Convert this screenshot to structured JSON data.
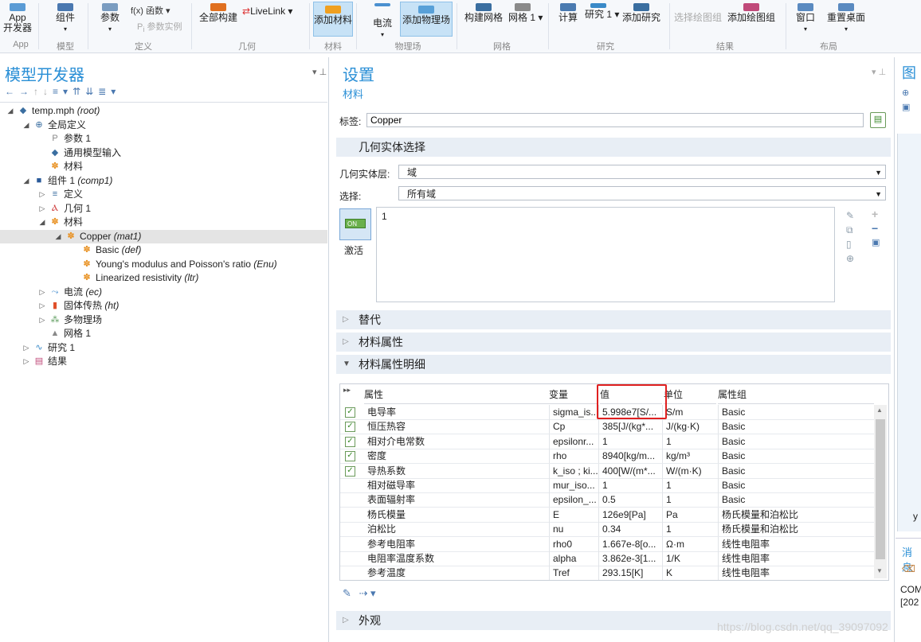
{
  "ribbon": {
    "app_builder": "App\n开发器",
    "components": "组件",
    "parameters": "参数",
    "functions": "f(x) 函数",
    "param_instance": "参数实例",
    "build_all": "全部构建",
    "livelink": "LiveLink",
    "add_material": "添加材料",
    "current": "电流",
    "add_multiphysics": "添加物理场",
    "build_mesh": "构建网格",
    "mesh1": "网格 1",
    "compute": "计算",
    "study1": "研究 1",
    "add_study": "添加研究",
    "select_plot_group": "选择绘图组",
    "add_plot_group": "添加绘图组",
    "window": "窗口",
    "reset_desktop": "重置桌面",
    "groups": [
      "App",
      "模型",
      "定义",
      "几何",
      "材料",
      "物理场",
      "网格",
      "研究",
      "结果",
      "布局"
    ]
  },
  "left": {
    "title": "模型开发器",
    "tree": [
      {
        "text": "temp.mph",
        "tag": "(root)",
        "icon": "document-icon"
      },
      {
        "text": "全局定义",
        "tag": "",
        "icon": "globe-icon"
      },
      {
        "text": "参数 1",
        "tag": "",
        "icon": "parameter-icon"
      },
      {
        "text": "通用模型输入",
        "tag": "",
        "icon": "model-input-icon"
      },
      {
        "text": "材料",
        "tag": "",
        "icon": "material-icon"
      },
      {
        "text": "组件 1",
        "tag": "(comp1)",
        "icon": "component-icon"
      },
      {
        "text": "定义",
        "tag": "",
        "icon": "definitions-icon"
      },
      {
        "text": "几何 1",
        "tag": "",
        "icon": "geometry-icon"
      },
      {
        "text": "材料",
        "tag": "",
        "icon": "material-icon"
      },
      {
        "text": "Copper",
        "tag": "(mat1)",
        "icon": "material-icon"
      },
      {
        "text": "Basic",
        "tag": "(def)",
        "icon": "material-icon"
      },
      {
        "text": "Young's modulus and Poisson's ratio",
        "tag": "(Enu)",
        "icon": "material-icon"
      },
      {
        "text": "Linearized resistivity",
        "tag": "(ltr)",
        "icon": "material-icon"
      },
      {
        "text": "电流",
        "tag": "(ec)",
        "icon": "current-icon"
      },
      {
        "text": "固体传热",
        "tag": "(ht)",
        "icon": "heat-transfer-icon"
      },
      {
        "text": "多物理场",
        "tag": "",
        "icon": "multiphysics-icon"
      },
      {
        "text": "网格 1",
        "tag": "",
        "icon": "mesh-icon"
      },
      {
        "text": "研究 1",
        "tag": "",
        "icon": "study-icon"
      },
      {
        "text": "结果",
        "tag": "",
        "icon": "results-icon"
      }
    ]
  },
  "settings": {
    "title": "设置",
    "subtitle": "材料",
    "label_caption": "标签:",
    "label_value": "Copper",
    "geom_section": "几何实体选择",
    "geom_level_caption": "几何实体层:",
    "geom_level_value": "域",
    "selection_caption": "选择:",
    "selection_value": "所有域",
    "activate_label": "激活",
    "toggle_text": "ON",
    "selection_list": [
      "1"
    ],
    "sections": {
      "override": "替代",
      "material_props": "材料属性",
      "material_contents": "材料属性明细",
      "appearance": "外观"
    },
    "table": {
      "columns": [
        "属性",
        "变量",
        "值",
        "单位",
        "属性组"
      ],
      "rows": [
        {
          "checked": true,
          "prop": "电导率",
          "var": "sigma_is...",
          "value": "5.998e7[S/...",
          "unit": "S/m",
          "group": "Basic"
        },
        {
          "checked": true,
          "prop": "恒压热容",
          "var": "Cp",
          "value": "385[J/(kg*...",
          "unit": "J/(kg·K)",
          "group": "Basic"
        },
        {
          "checked": true,
          "prop": "相对介电常数",
          "var": "epsilonr...",
          "value": "1",
          "unit": "1",
          "group": "Basic"
        },
        {
          "checked": true,
          "prop": "密度",
          "var": "rho",
          "value": "8940[kg/m...",
          "unit": "kg/m³",
          "group": "Basic"
        },
        {
          "checked": true,
          "prop": "导热系数",
          "var": "k_iso ; ki...",
          "value": "400[W/(m*...",
          "unit": "W/(m·K)",
          "group": "Basic"
        },
        {
          "checked": false,
          "prop": "相对磁导率",
          "var": "mur_iso...",
          "value": "1",
          "unit": "1",
          "group": "Basic"
        },
        {
          "checked": false,
          "prop": "表面辐射率",
          "var": "epsilon_...",
          "value": "0.5",
          "unit": "1",
          "group": "Basic"
        },
        {
          "checked": false,
          "prop": "杨氏模量",
          "var": "E",
          "value": "126e9[Pa]",
          "unit": "Pa",
          "group": "杨氏模量和泊松比"
        },
        {
          "checked": false,
          "prop": "泊松比",
          "var": "nu",
          "value": "0.34",
          "unit": "1",
          "group": "杨氏模量和泊松比"
        },
        {
          "checked": false,
          "prop": "参考电阻率",
          "var": "rho0",
          "value": "1.667e-8[o...",
          "unit": "Ω·m",
          "group": "线性电阻率"
        },
        {
          "checked": false,
          "prop": "电阻率温度系数",
          "var": "alpha",
          "value": "3.862e-3[1...",
          "unit": "1/K",
          "group": "线性电阻率"
        },
        {
          "checked": false,
          "prop": "参考温度",
          "var": "Tref",
          "value": "293.15[K]",
          "unit": "K",
          "group": "线性电阻率"
        }
      ]
    },
    "highlight_color": "#e02020"
  },
  "right": {
    "title": "图",
    "messages": "消息",
    "com_text": "COM",
    "year_text": "[202",
    "y_axis": "y"
  },
  "watermark": "https://blog.csdn.net/qq_39097092"
}
